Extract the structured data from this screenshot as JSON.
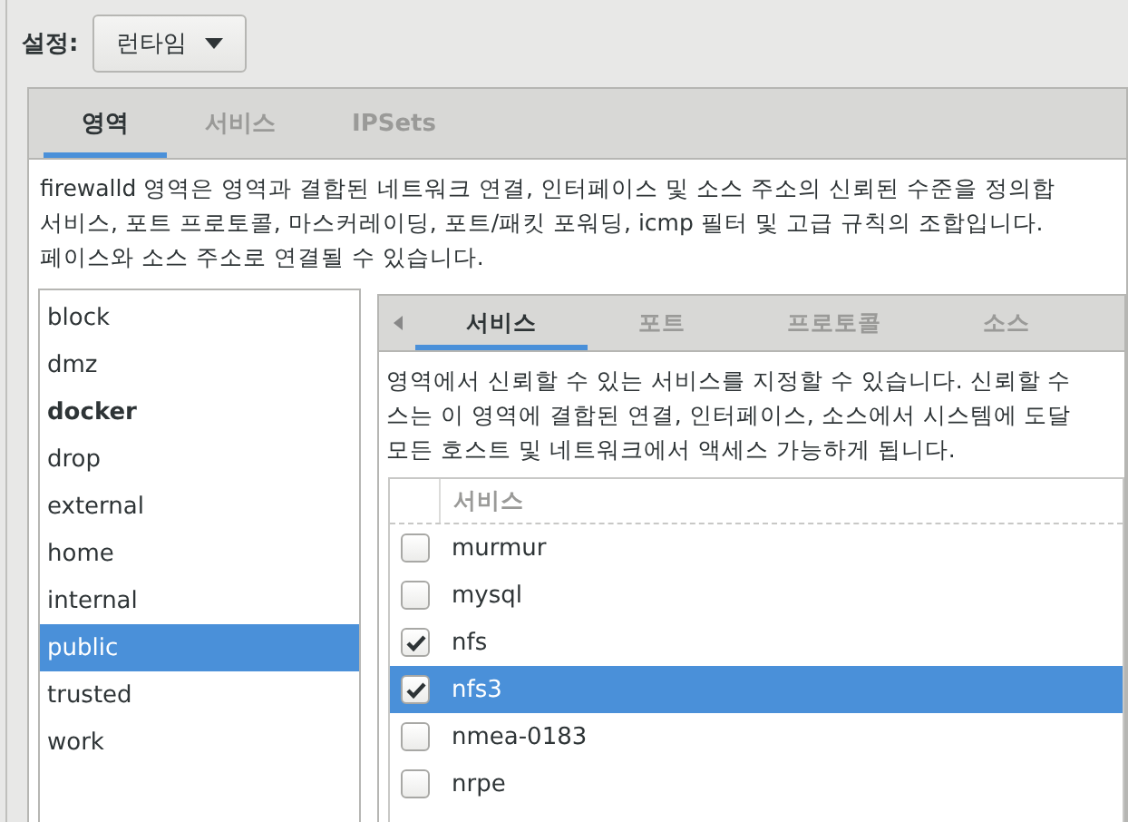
{
  "settings": {
    "label": "설정:",
    "dropdown": "런타임"
  },
  "tabs": [
    {
      "label": "영역",
      "selected": true
    },
    {
      "label": "서비스",
      "selected": false
    },
    {
      "label": "IPSets",
      "selected": false
    }
  ],
  "description": [
    "firewalld 영역은 영역과 결합된 네트워크 연결, 인터페이스 및 소스 주소의 신뢰된 수준을 정의합",
    "서비스, 포트 프로토콜, 마스커레이딩, 포트/패킷 포워딩, icmp 필터 및 고급 규칙의 조합입니다.",
    "페이스와 소스 주소로 연결될 수 있습니다."
  ],
  "zones": [
    {
      "name": "block",
      "default": false,
      "selected": false
    },
    {
      "name": "dmz",
      "default": false,
      "selected": false
    },
    {
      "name": "docker",
      "default": true,
      "selected": false
    },
    {
      "name": "drop",
      "default": false,
      "selected": false
    },
    {
      "name": "external",
      "default": false,
      "selected": false
    },
    {
      "name": "home",
      "default": false,
      "selected": false
    },
    {
      "name": "internal",
      "default": false,
      "selected": false
    },
    {
      "name": "public",
      "default": false,
      "selected": true
    },
    {
      "name": "trusted",
      "default": false,
      "selected": false
    },
    {
      "name": "work",
      "default": false,
      "selected": false
    }
  ],
  "zone_tabs": [
    {
      "label": "서비스",
      "selected": true
    },
    {
      "label": "포트",
      "selected": false
    },
    {
      "label": "프로토콜",
      "selected": false
    },
    {
      "label": "소스",
      "selected": false
    }
  ],
  "zone_description": [
    "영역에서 신뢰할 수 있는 서비스를 지정할 수 있습니다. 신뢰할 수",
    "스는 이 영역에 결합된 연결, 인터페이스, 소스에서 시스템에 도달",
    "모든 호스트 및 네트워크에서 액세스 가능하게 됩니다."
  ],
  "services": {
    "column": "서비스",
    "rows": [
      {
        "name": "murmur",
        "checked": false,
        "selected": false
      },
      {
        "name": "mysql",
        "checked": false,
        "selected": false
      },
      {
        "name": "nfs",
        "checked": true,
        "selected": false
      },
      {
        "name": "nfs3",
        "checked": true,
        "selected": true
      },
      {
        "name": "nmea-0183",
        "checked": false,
        "selected": false
      },
      {
        "name": "nrpe",
        "checked": false,
        "selected": false
      }
    ]
  }
}
